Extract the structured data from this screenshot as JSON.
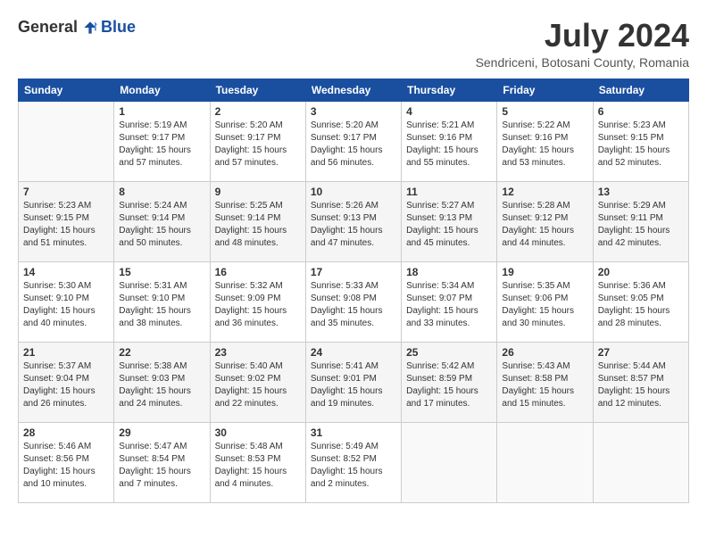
{
  "logo": {
    "general": "General",
    "blue": "Blue"
  },
  "title": "July 2024",
  "subtitle": "Sendriceni, Botosani County, Romania",
  "days_of_week": [
    "Sunday",
    "Monday",
    "Tuesday",
    "Wednesday",
    "Thursday",
    "Friday",
    "Saturday"
  ],
  "weeks": [
    [
      {
        "day": "",
        "content": ""
      },
      {
        "day": "1",
        "content": "Sunrise: 5:19 AM\nSunset: 9:17 PM\nDaylight: 15 hours\nand 57 minutes."
      },
      {
        "day": "2",
        "content": "Sunrise: 5:20 AM\nSunset: 9:17 PM\nDaylight: 15 hours\nand 57 minutes."
      },
      {
        "day": "3",
        "content": "Sunrise: 5:20 AM\nSunset: 9:17 PM\nDaylight: 15 hours\nand 56 minutes."
      },
      {
        "day": "4",
        "content": "Sunrise: 5:21 AM\nSunset: 9:16 PM\nDaylight: 15 hours\nand 55 minutes."
      },
      {
        "day": "5",
        "content": "Sunrise: 5:22 AM\nSunset: 9:16 PM\nDaylight: 15 hours\nand 53 minutes."
      },
      {
        "day": "6",
        "content": "Sunrise: 5:23 AM\nSunset: 9:15 PM\nDaylight: 15 hours\nand 52 minutes."
      }
    ],
    [
      {
        "day": "7",
        "content": "Sunrise: 5:23 AM\nSunset: 9:15 PM\nDaylight: 15 hours\nand 51 minutes."
      },
      {
        "day": "8",
        "content": "Sunrise: 5:24 AM\nSunset: 9:14 PM\nDaylight: 15 hours\nand 50 minutes."
      },
      {
        "day": "9",
        "content": "Sunrise: 5:25 AM\nSunset: 9:14 PM\nDaylight: 15 hours\nand 48 minutes."
      },
      {
        "day": "10",
        "content": "Sunrise: 5:26 AM\nSunset: 9:13 PM\nDaylight: 15 hours\nand 47 minutes."
      },
      {
        "day": "11",
        "content": "Sunrise: 5:27 AM\nSunset: 9:13 PM\nDaylight: 15 hours\nand 45 minutes."
      },
      {
        "day": "12",
        "content": "Sunrise: 5:28 AM\nSunset: 9:12 PM\nDaylight: 15 hours\nand 44 minutes."
      },
      {
        "day": "13",
        "content": "Sunrise: 5:29 AM\nSunset: 9:11 PM\nDaylight: 15 hours\nand 42 minutes."
      }
    ],
    [
      {
        "day": "14",
        "content": "Sunrise: 5:30 AM\nSunset: 9:10 PM\nDaylight: 15 hours\nand 40 minutes."
      },
      {
        "day": "15",
        "content": "Sunrise: 5:31 AM\nSunset: 9:10 PM\nDaylight: 15 hours\nand 38 minutes."
      },
      {
        "day": "16",
        "content": "Sunrise: 5:32 AM\nSunset: 9:09 PM\nDaylight: 15 hours\nand 36 minutes."
      },
      {
        "day": "17",
        "content": "Sunrise: 5:33 AM\nSunset: 9:08 PM\nDaylight: 15 hours\nand 35 minutes."
      },
      {
        "day": "18",
        "content": "Sunrise: 5:34 AM\nSunset: 9:07 PM\nDaylight: 15 hours\nand 33 minutes."
      },
      {
        "day": "19",
        "content": "Sunrise: 5:35 AM\nSunset: 9:06 PM\nDaylight: 15 hours\nand 30 minutes."
      },
      {
        "day": "20",
        "content": "Sunrise: 5:36 AM\nSunset: 9:05 PM\nDaylight: 15 hours\nand 28 minutes."
      }
    ],
    [
      {
        "day": "21",
        "content": "Sunrise: 5:37 AM\nSunset: 9:04 PM\nDaylight: 15 hours\nand 26 minutes."
      },
      {
        "day": "22",
        "content": "Sunrise: 5:38 AM\nSunset: 9:03 PM\nDaylight: 15 hours\nand 24 minutes."
      },
      {
        "day": "23",
        "content": "Sunrise: 5:40 AM\nSunset: 9:02 PM\nDaylight: 15 hours\nand 22 minutes."
      },
      {
        "day": "24",
        "content": "Sunrise: 5:41 AM\nSunset: 9:01 PM\nDaylight: 15 hours\nand 19 minutes."
      },
      {
        "day": "25",
        "content": "Sunrise: 5:42 AM\nSunset: 8:59 PM\nDaylight: 15 hours\nand 17 minutes."
      },
      {
        "day": "26",
        "content": "Sunrise: 5:43 AM\nSunset: 8:58 PM\nDaylight: 15 hours\nand 15 minutes."
      },
      {
        "day": "27",
        "content": "Sunrise: 5:44 AM\nSunset: 8:57 PM\nDaylight: 15 hours\nand 12 minutes."
      }
    ],
    [
      {
        "day": "28",
        "content": "Sunrise: 5:46 AM\nSunset: 8:56 PM\nDaylight: 15 hours\nand 10 minutes."
      },
      {
        "day": "29",
        "content": "Sunrise: 5:47 AM\nSunset: 8:54 PM\nDaylight: 15 hours\nand 7 minutes."
      },
      {
        "day": "30",
        "content": "Sunrise: 5:48 AM\nSunset: 8:53 PM\nDaylight: 15 hours\nand 4 minutes."
      },
      {
        "day": "31",
        "content": "Sunrise: 5:49 AM\nSunset: 8:52 PM\nDaylight: 15 hours\nand 2 minutes."
      },
      {
        "day": "",
        "content": ""
      },
      {
        "day": "",
        "content": ""
      },
      {
        "day": "",
        "content": ""
      }
    ]
  ]
}
